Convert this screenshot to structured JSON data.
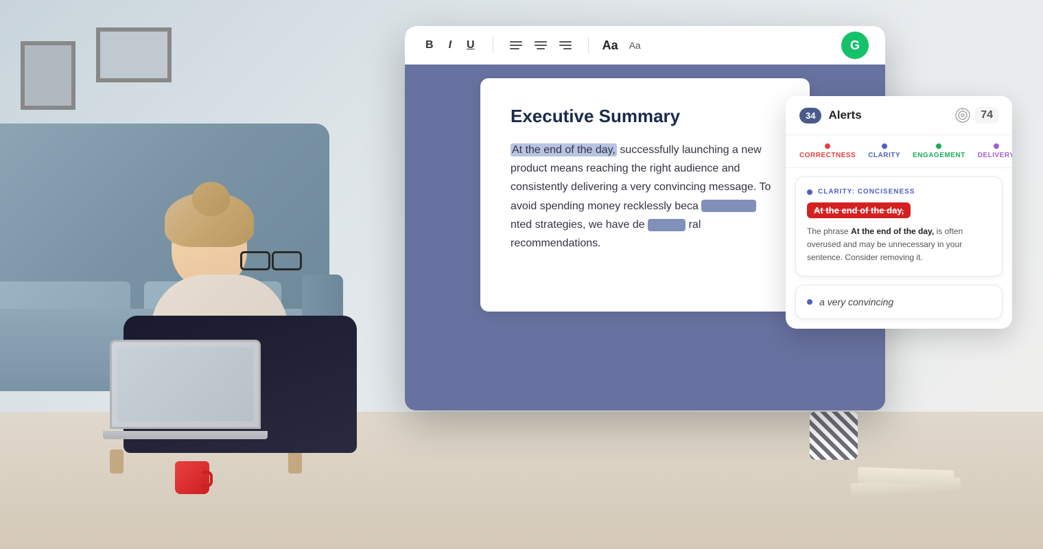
{
  "background": {
    "color": "#e8ecef"
  },
  "toolbar": {
    "bold_label": "B",
    "italic_label": "I",
    "underline_label": "U",
    "font_size_label": "Aa",
    "font_aa_label": "Aa",
    "grammarly_badge_label": "G"
  },
  "editor": {
    "title": "Executive Summary",
    "paragraph": {
      "part1": "At the end of the day,",
      "part2": " successfully launching a new product means reaching the right audience and consistently delivering a very convincing message. To avoid spending money recklessly beca",
      "part3": "nted strategies, we have de",
      "part4": "ral recommendations."
    }
  },
  "sidebar": {
    "alerts_count": "34",
    "alerts_label": "Alerts",
    "score": "74",
    "categories": [
      {
        "id": "correctness",
        "label": "CORRECTNESS"
      },
      {
        "id": "clarity",
        "label": "CLARITY"
      },
      {
        "id": "engagement",
        "label": "ENGAGEMENT"
      },
      {
        "id": "delivery",
        "label": "DELIVERY"
      }
    ],
    "card1": {
      "category_label": "CLARITY: CONCISENESS",
      "highlighted_text": "At the end of the day,",
      "description_prefix": "The phrase ",
      "description_bold": "At the end of the day,",
      "description_suffix": " is often overused and may be unnecessary in your sentence. Consider removing it."
    },
    "card2": {
      "text": "a very convincing"
    }
  }
}
